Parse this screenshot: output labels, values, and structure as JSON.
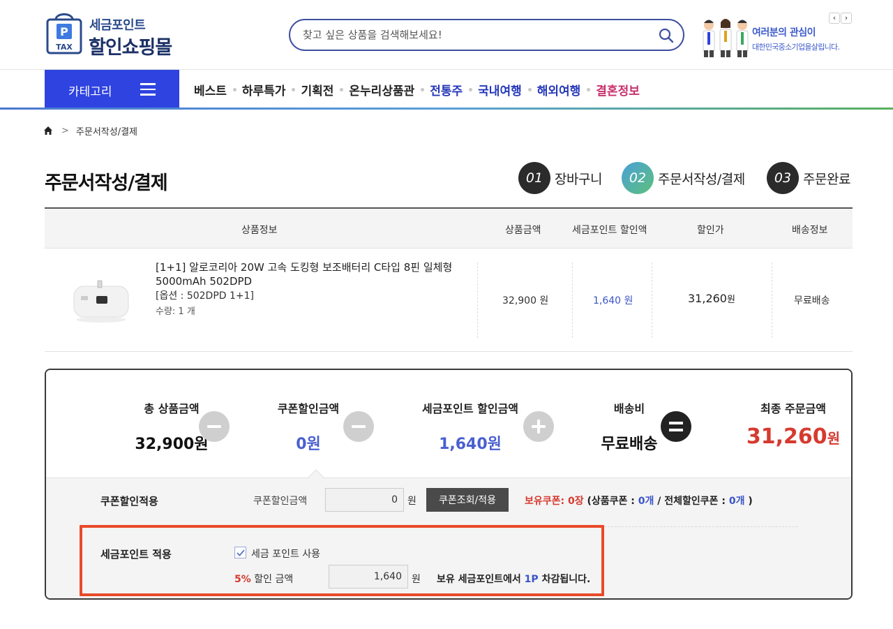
{
  "header": {
    "logo_line1": "세금포인트",
    "logo_line2": "할인쇼핑몰",
    "logo_badge_p": "P",
    "logo_badge_tax": "TAX",
    "search_placeholder": "찾고 싶은 상품을 검색해보세요!",
    "banner_line1": "여러분의 관심이",
    "banner_line2": "대한민국중소기업을살립니다.",
    "banner_prev": "‹",
    "banner_next": "›"
  },
  "nav": {
    "category_label": "카테고리",
    "items": [
      "베스트",
      "하루특가",
      "기획전",
      "온누리상품관",
      "전통주",
      "국내여행",
      "해외여행",
      "결혼정보"
    ]
  },
  "breadcrumb": {
    "current": "주문서작성/결제",
    "separator": ">"
  },
  "page": {
    "title": "주문서작성/결제",
    "steps": [
      {
        "num": "01",
        "label": "장바구니"
      },
      {
        "num": "02",
        "label": "주문서작성/결제"
      },
      {
        "num": "03",
        "label": "주문완료"
      }
    ]
  },
  "table": {
    "headers": [
      "상품정보",
      "상품금액",
      "세금포인트 할인액",
      "할인가",
      "배송정보"
    ],
    "product": {
      "name": "[1+1] 알로코리아 20W 고속 도킹형 보조배터리 C타입 8핀 일체형 5000mAh 502DPD",
      "option": "[옵션 : 502DPD 1+1]",
      "quantity": "수량: 1 개",
      "price": "32,900 원",
      "point_discount": "1,640 원",
      "discounted_amount": "31,260",
      "discounted_unit": "원",
      "shipping": "무료배송"
    }
  },
  "summary": {
    "total_label": "총 상품금액",
    "total_value": "32,900원",
    "coupon_label": "쿠폰할인금액",
    "coupon_value": "0원",
    "point_label": "세금포인트 할인금액",
    "point_value": "1,640원",
    "shipping_label": "배송비",
    "shipping_value": "무료배송",
    "final_label": "최종 주문금액",
    "final_amount": "31,260",
    "final_unit": "원"
  },
  "coupon_section": {
    "label": "쿠폰할인적용",
    "amount_label": "쿠폰할인금액",
    "amount_value": "0",
    "unit": "원",
    "button": "쿠폰조회/적용",
    "owned_label": "보유쿠폰:",
    "owned_count": "0장",
    "product_coupon_label": "(상품쿠폰 :",
    "product_coupon_count": "0개",
    "slash": "/",
    "all_coupon_label": "전체할인쿠폰 :",
    "all_coupon_count": "0개",
    "close_paren": ")"
  },
  "point_section": {
    "label": "세금포인트 적용",
    "checkbox_label": "세금 포인트 사용",
    "checked": true,
    "rate": "5%",
    "rate_label": "할인 금액",
    "amount_value": "1,640",
    "unit": "원",
    "deduct_prefix": "보유 세금포인트에서",
    "deduct_value": "1P",
    "deduct_suffix": "차감됩니다."
  },
  "colors": {
    "brand_blue": "#2f43e0",
    "highlight_red": "#e84a2a",
    "price_red": "#d63a2f",
    "point_blue": "#4a5fd0"
  }
}
